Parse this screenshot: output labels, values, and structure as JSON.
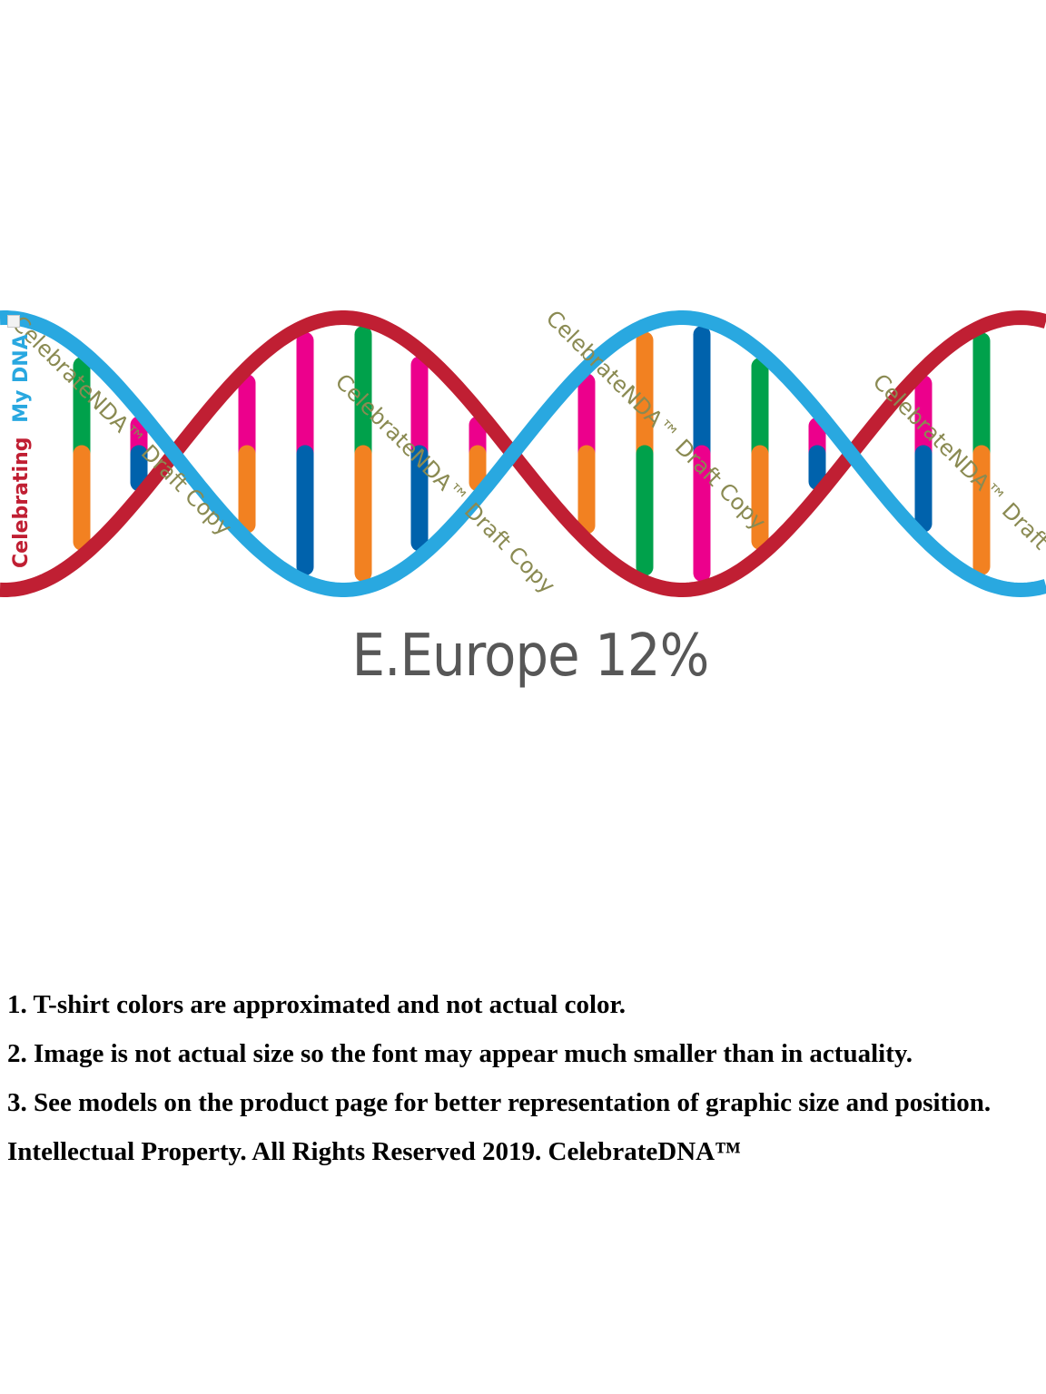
{
  "logo": {
    "brand_part_1": "Celebrating",
    "brand_part_2": "My DNA"
  },
  "watermark": "CelebrateNDA™ Draft Copy",
  "design_text": "E.Europe 12%",
  "notes": [
    "1. T-shirt colors are approximated and not actual color.",
    "2. Image is not actual size so the font may appear much smaller than in actuality.",
    "3. See models on the product page for better representation of graphic size and position.",
    "Intellectual Property. All Rights Reserved 2019. CelebrateDNA™"
  ],
  "colors": {
    "strand_red": "#c01f33",
    "strand_blue": "#29a8e0",
    "green": "#00a14b",
    "orange": "#f28121",
    "magenta": "#ec008c",
    "dark_blue": "#0062ac",
    "watermark": "#8a8a52",
    "tagline": "#575757"
  }
}
